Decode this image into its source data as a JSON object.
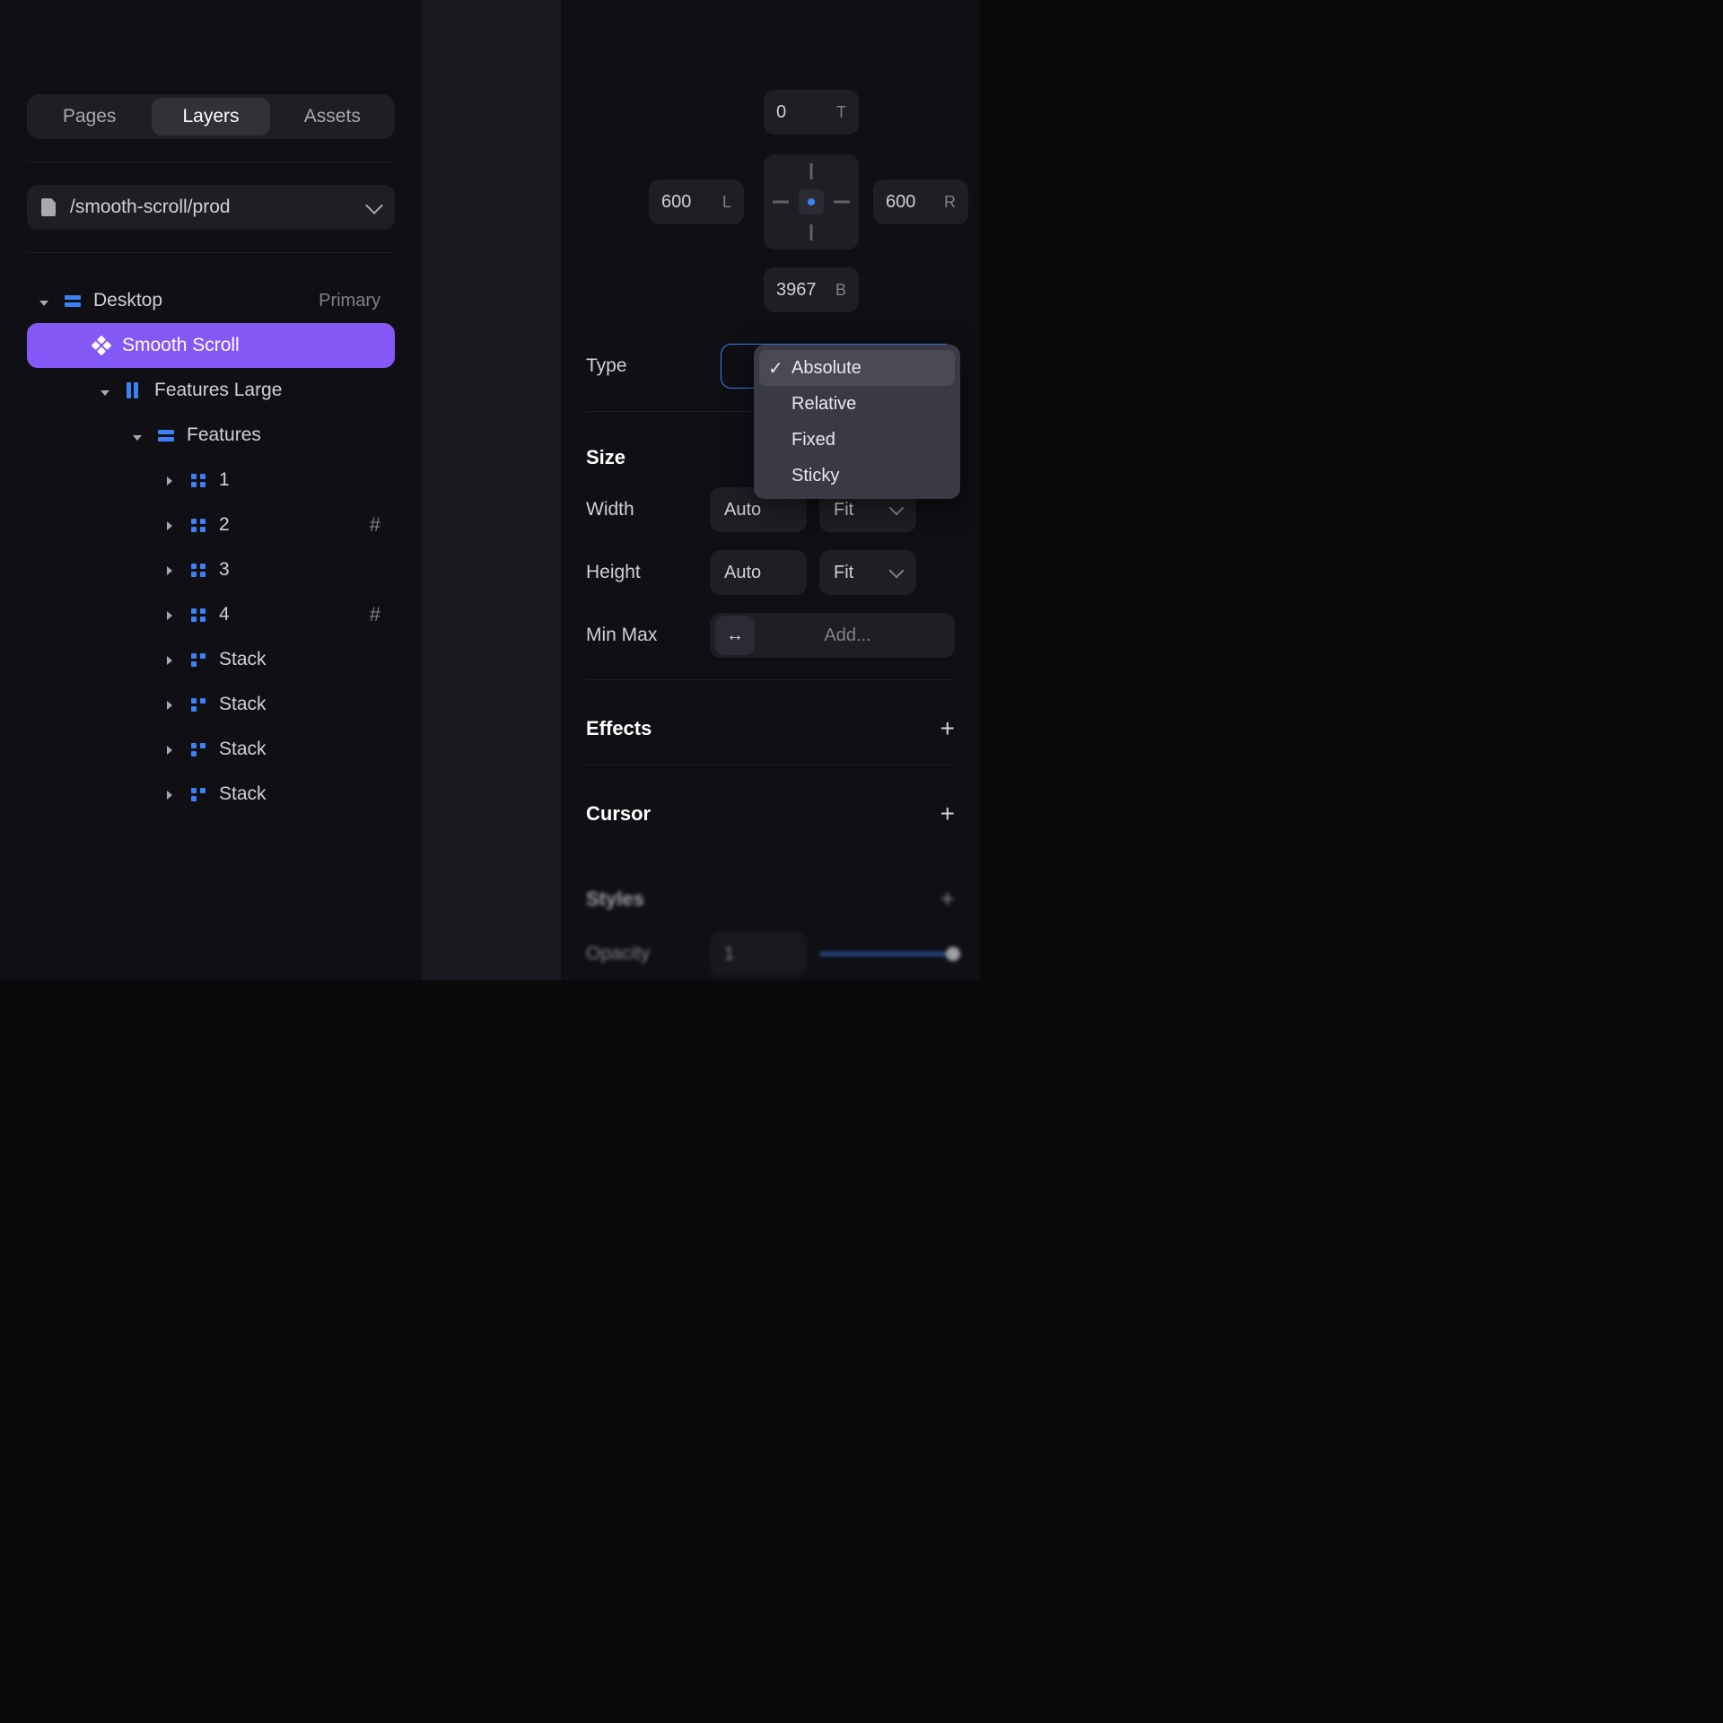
{
  "left": {
    "tabs": [
      "Pages",
      "Layers",
      "Assets"
    ],
    "active_tab": 1,
    "page_path": "/smooth-scroll/prod",
    "tree": [
      {
        "indent": 0,
        "exp": "down",
        "icon": "stack",
        "label": "Desktop",
        "suffix": "Primary"
      },
      {
        "indent": 1,
        "exp": "",
        "icon": "diamond",
        "label": "Smooth Scroll",
        "selected": true
      },
      {
        "indent": 2,
        "exp": "down",
        "icon": "cols",
        "label": "Features Large"
      },
      {
        "indent": 3,
        "exp": "down",
        "icon": "stack",
        "label": "Features"
      },
      {
        "indent": 4,
        "exp": "right",
        "icon": "grid",
        "label": "1"
      },
      {
        "indent": 4,
        "exp": "right",
        "icon": "grid",
        "label": "2",
        "suffix": "#"
      },
      {
        "indent": 4,
        "exp": "right",
        "icon": "grid",
        "label": "3"
      },
      {
        "indent": 4,
        "exp": "right",
        "icon": "grid",
        "label": "4",
        "suffix": "#"
      },
      {
        "indent": 4,
        "exp": "right",
        "icon": "grid3",
        "label": "Stack"
      },
      {
        "indent": 4,
        "exp": "right",
        "icon": "grid3",
        "label": "Stack"
      },
      {
        "indent": 4,
        "exp": "right",
        "icon": "grid3",
        "label": "Stack"
      },
      {
        "indent": 4,
        "exp": "right",
        "icon": "grid3",
        "label": "Stack"
      }
    ]
  },
  "right": {
    "pos_top": "0",
    "pos_left": "600",
    "pos_right": "600",
    "pos_bottom": "3967",
    "unit_t": "T",
    "unit_l": "L",
    "unit_r": "R",
    "unit_b": "B",
    "type_label": "Type",
    "type_options": [
      "Absolute",
      "Relative",
      "Fixed",
      "Sticky"
    ],
    "type_selected": 0,
    "size_header": "Size",
    "width_label": "Width",
    "height_label": "Height",
    "minmax_label": "Min Max",
    "width_value": "Auto",
    "width_mode": "Fit",
    "height_value": "Auto",
    "height_mode": "Fit",
    "minmax_placeholder": "Add...",
    "sections": [
      "Effects",
      "Cursor",
      "Styles"
    ],
    "opacity_label": "Opacity",
    "opacity_value": "1"
  }
}
